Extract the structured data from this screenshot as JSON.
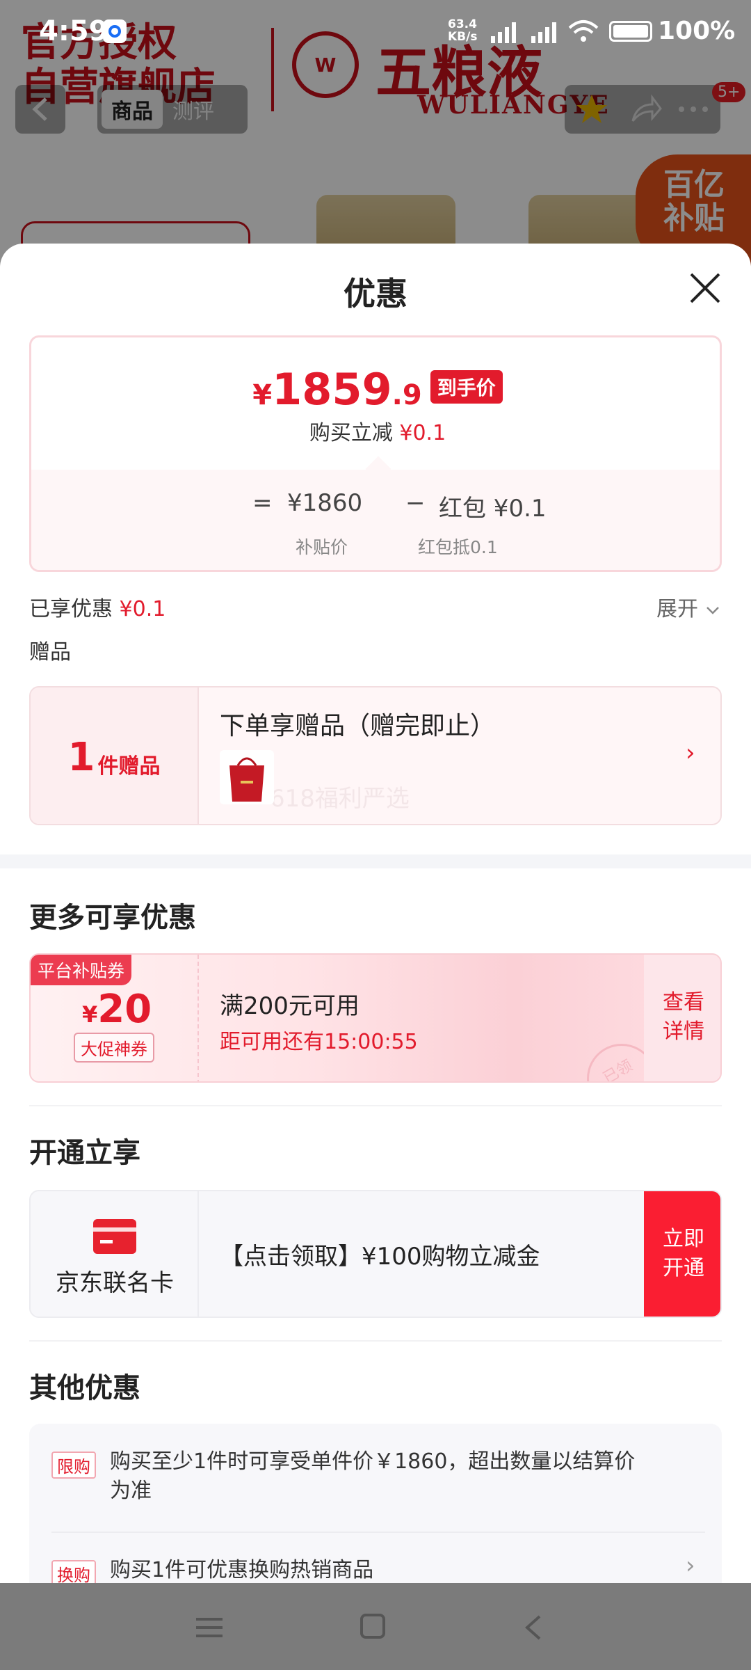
{
  "status_bar": {
    "time": "4:59",
    "net_speed_top": "63.4",
    "net_speed_unit": "KB/s",
    "battery": "100%"
  },
  "background_page": {
    "store_text_line1": "官方授权",
    "store_text_line2": "自营旗舰店",
    "brand_cn": "五粮液",
    "brand_en": "WULIANGYE",
    "tab_goods": "商品",
    "tab_review": "测评",
    "cart_badge": "5+",
    "subsidy_line1": "百亿",
    "subsidy_line2": "补贴"
  },
  "sheet": {
    "title": "优惠",
    "price_card": {
      "yen": "¥",
      "price_int": "1859",
      "price_dec": ".9",
      "price_tag": "到手价",
      "instant_discount_label": "购买立减",
      "instant_discount_value": "¥0.1",
      "eq": "=",
      "base_price": "¥1860",
      "minus": "−",
      "red_packet": "红包 ¥0.1",
      "base_price_label": "补贴价",
      "red_packet_label": "红包抵0.1"
    },
    "enjoyed": {
      "label": "已享优惠",
      "value": "¥0.1",
      "expand": "展开"
    },
    "gift_section_label": "赠品",
    "gift_card": {
      "count": "1",
      "unit": "件赠品",
      "title": "下单享赠品（赠完即止）",
      "watermark": "618福利严选"
    },
    "more_title": "更多可享优惠",
    "coupon": {
      "tag": "平台补贴券",
      "yen": "¥",
      "amount": "20",
      "label": "大促神券",
      "title": "满200元可用",
      "countdown": "距可用还有15:00:55",
      "button_line1": "查看",
      "button_line2": "详情",
      "stamp": "已领"
    },
    "open_title": "开通立享",
    "jd_card": {
      "name": "京东联名卡",
      "desc": "【点击领取】¥100购物立减金",
      "button_line1": "立即",
      "button_line2": "开通"
    },
    "other_title": "其他优惠",
    "other_items": [
      {
        "tag": "限购",
        "text_line1": "购买至少1件时可享受单件价￥1860，超出数量以结算价",
        "text_line2": "为准"
      },
      {
        "tag": "换购",
        "text_line1": "购买1件可优惠换购热销商品"
      }
    ]
  },
  "colors": {
    "accent_red": "#e21b2c",
    "sheet_bg": "#ffffff",
    "navbar_bg": "#7b7b7b"
  }
}
